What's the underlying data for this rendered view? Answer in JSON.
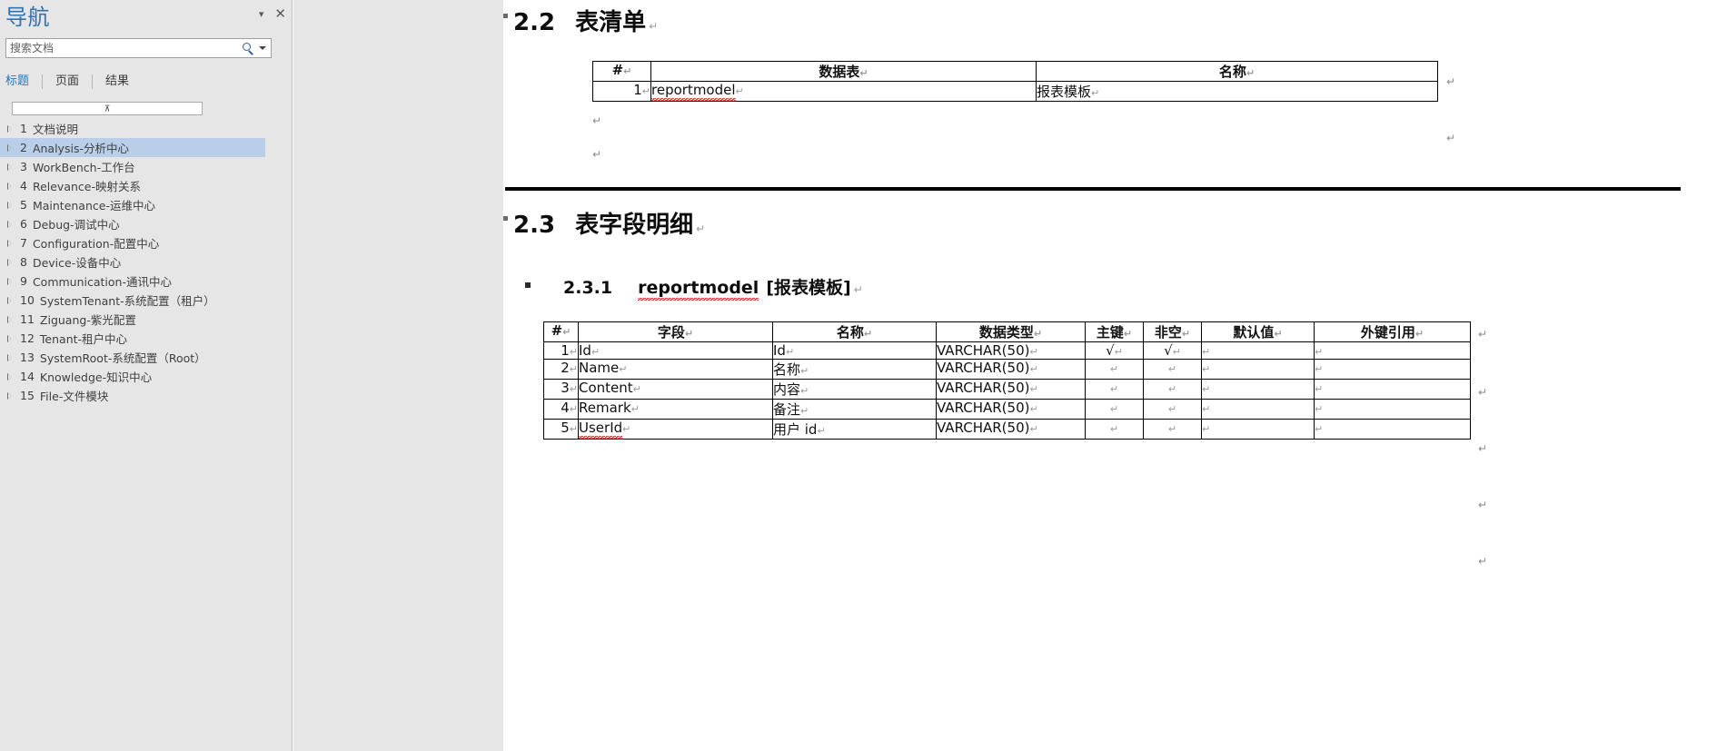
{
  "nav": {
    "title": "导航",
    "buttons": {
      "menu": "▾",
      "close": "✕"
    },
    "search": {
      "placeholder": "搜索文档",
      "value": "",
      "icon": "search-icon",
      "dropdown_icon": "chevron-down-icon"
    },
    "tabs": [
      {
        "label": "标题",
        "active": true
      },
      {
        "label": "页面",
        "active": false
      },
      {
        "label": "结果",
        "active": false
      }
    ],
    "collapse_glyph": "⊼",
    "tree": [
      {
        "num": "1",
        "label": "文档说明",
        "selected": false
      },
      {
        "num": "2",
        "label": "Analysis-分析中心",
        "selected": true
      },
      {
        "num": "3",
        "label": "WorkBench-工作台",
        "selected": false
      },
      {
        "num": "4",
        "label": "Relevance-映射关系",
        "selected": false
      },
      {
        "num": "5",
        "label": "Maintenance-运维中心",
        "selected": false
      },
      {
        "num": "6",
        "label": "Debug-调试中心",
        "selected": false
      },
      {
        "num": "7",
        "label": "Configuration-配置中心",
        "selected": false
      },
      {
        "num": "8",
        "label": "Device-设备中心",
        "selected": false
      },
      {
        "num": "9",
        "label": "Communication-通讯中心",
        "selected": false
      },
      {
        "num": "10",
        "label": "SystemTenant-系统配置（租户）",
        "selected": false
      },
      {
        "num": "11",
        "label": "Ziguang-紫光配置",
        "selected": false
      },
      {
        "num": "12",
        "label": "Tenant-租户中心",
        "selected": false
      },
      {
        "num": "13",
        "label": "SystemRoot-系统配置（Root）",
        "selected": false
      },
      {
        "num": "14",
        "label": "Knowledge-知识中心",
        "selected": false
      },
      {
        "num": "15",
        "label": "File-文件模块",
        "selected": false
      }
    ]
  },
  "document": {
    "heading_2_2": {
      "number": "2.2",
      "text": "表清单",
      "pilcrow": "↵"
    },
    "table_list": {
      "headers": [
        "#",
        "数据表",
        "名称"
      ],
      "header_pilcrow": "↵",
      "rows": [
        {
          "num": "1",
          "table": "reportmodel",
          "name": "报表模板",
          "misspelled": true
        }
      ],
      "row_pilcrow": "↵",
      "margin_pilcrows": [
        "↵",
        "↵"
      ],
      "paragraph_pilcrows": [
        "↵",
        "↵"
      ]
    },
    "heading_2_3": {
      "number": "2.3",
      "text": "表字段明细",
      "pilcrow": "↵"
    },
    "heading_2_3_1": {
      "number": "2.3.1",
      "code": "reportmodel",
      "name": "[报表模板]",
      "pilcrow": "↵"
    },
    "table_fields": {
      "headers": [
        "#",
        "字段",
        "名称",
        "数据类型",
        "主键",
        "非空",
        "默认值",
        "外键引用"
      ],
      "header_pilcrow": "↵",
      "pilcrow": "↵",
      "check": "√",
      "rows": [
        {
          "num": "1",
          "field": "Id",
          "name": "Id",
          "type": "VARCHAR(50)",
          "pk": "√",
          "notnull": "√",
          "default": "",
          "fk": "",
          "misspelled": false
        },
        {
          "num": "2",
          "field": "Name",
          "name": "名称",
          "type": "VARCHAR(50)",
          "pk": "",
          "notnull": "",
          "default": "",
          "fk": "",
          "misspelled": false
        },
        {
          "num": "3",
          "field": "Content",
          "name": "内容",
          "type": "VARCHAR(50)",
          "pk": "",
          "notnull": "",
          "default": "",
          "fk": "",
          "misspelled": false
        },
        {
          "num": "4",
          "field": "Remark",
          "name": "备注",
          "type": "VARCHAR(50)",
          "pk": "",
          "notnull": "",
          "default": "",
          "fk": "",
          "misspelled": false
        },
        {
          "num": "5",
          "field": "UserId",
          "name": "用户 id",
          "type": "VARCHAR(50)",
          "pk": "",
          "notnull": "",
          "default": "",
          "fk": "",
          "misspelled": true
        }
      ]
    }
  },
  "colors": {
    "nav_title": "#2e74b5",
    "tab_active": "#2e74b5",
    "selection": "#b9cfe9",
    "pane_bg": "#e6e6e6",
    "spell_error": "#ee0000"
  }
}
